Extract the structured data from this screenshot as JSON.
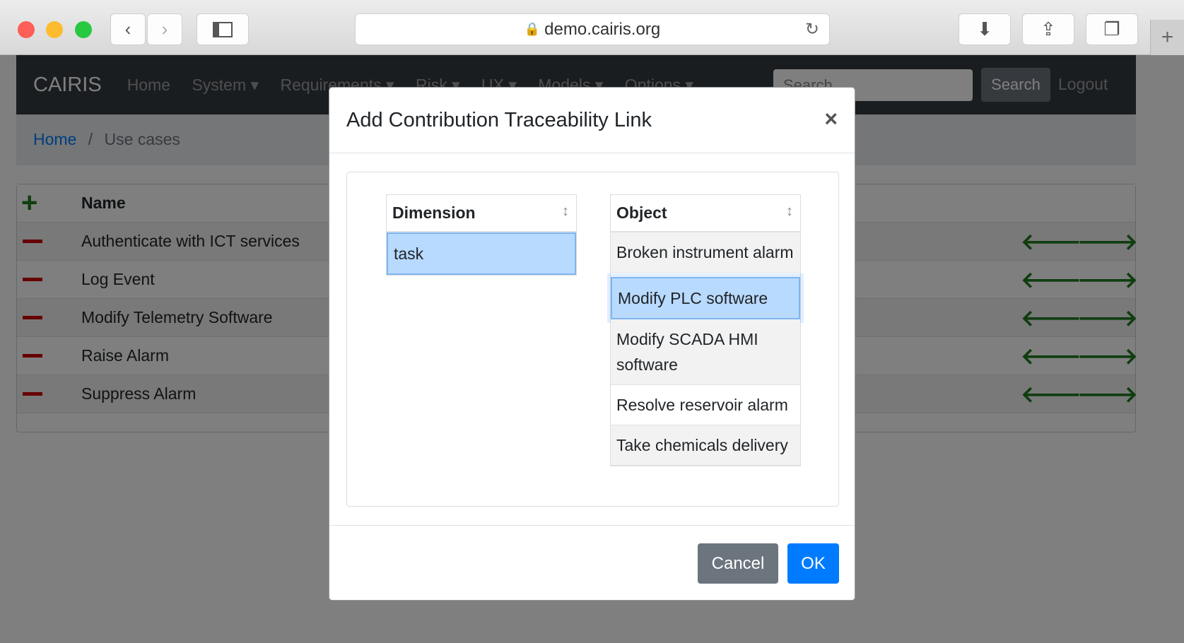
{
  "browser": {
    "url": "demo.cairis.org"
  },
  "navbar": {
    "brand": "CAIRIS",
    "items": [
      "Home",
      "System ▾",
      "Requirements ▾",
      "Risk ▾",
      "UX ▾",
      "Models ▾",
      "Options ▾"
    ],
    "search_placeholder": "Search...",
    "search_button": "Search",
    "logout": "Logout"
  },
  "breadcrumb": {
    "home": "Home",
    "separator": "/",
    "current": "Use cases"
  },
  "table": {
    "add_icon": "+",
    "header": "Name",
    "rows": [
      "Authenticate with ICT services",
      "Log Event",
      "Modify Telemetry Software",
      "Raise Alarm",
      "Suppress Alarm"
    ],
    "left_arrow": "🡐",
    "right_arrow": "🡒"
  },
  "modal": {
    "title": "Add Contribution Traceability Link",
    "close": "×",
    "dimension": {
      "header": "Dimension",
      "sort_icon": "↕",
      "rows": [
        "task"
      ],
      "selected": "task"
    },
    "object": {
      "header": "Object",
      "sort_icon": "↕",
      "rows": [
        "Broken instrument alarm",
        "Modify PLC software",
        "Modify SCADA HMI software",
        "Resolve reservoir alarm",
        "Take chemicals delivery"
      ],
      "selected": "Modify PLC software"
    },
    "cancel": "Cancel",
    "ok": "OK"
  },
  "colors": {
    "primary": "#007bff",
    "secondary": "#6c757d",
    "navbar": "#343a40",
    "selected": "#b8daff"
  }
}
